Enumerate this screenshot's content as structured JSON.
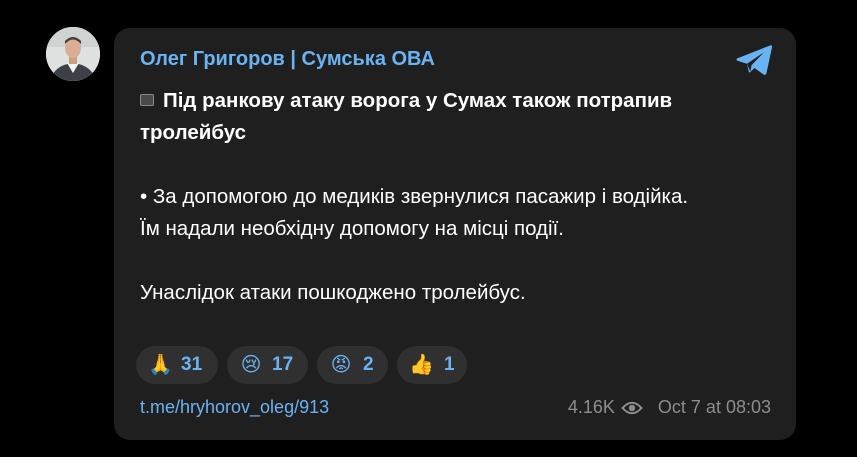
{
  "post": {
    "author": "Олег Григоров | Сумська ОВА",
    "title": "Під ранкову атаку ворога у Сумах також потрапив тролейбус",
    "body_line1": "• За допомогою до медиків звернулися пасажир і водійка.",
    "body_line2": "Їм надали необхідну допомогу на місці події.",
    "body_line3": "Унаслідок атаки пошкоджено тролейбус.",
    "link": "t.me/hryhorov_oleg/913",
    "views": "4.16K",
    "datetime": "Oct 7 at 08:03"
  },
  "reactions": [
    {
      "icon": "folded-hands-icon",
      "emoji": "🙏",
      "count": "31"
    },
    {
      "icon": "crying-face-icon",
      "emoji": "😢",
      "count": "17"
    },
    {
      "icon": "angry-face-icon",
      "emoji": "😡",
      "count": "2"
    },
    {
      "icon": "thumbs-up-icon",
      "emoji": "👍",
      "count": "1"
    }
  ],
  "colors": {
    "background": "#000000",
    "bubble": "#1f1f1f",
    "accent": "#6ab3f3",
    "text": "#ffffff",
    "muted": "#8d8d8d",
    "reaction_bg": "#303030"
  }
}
